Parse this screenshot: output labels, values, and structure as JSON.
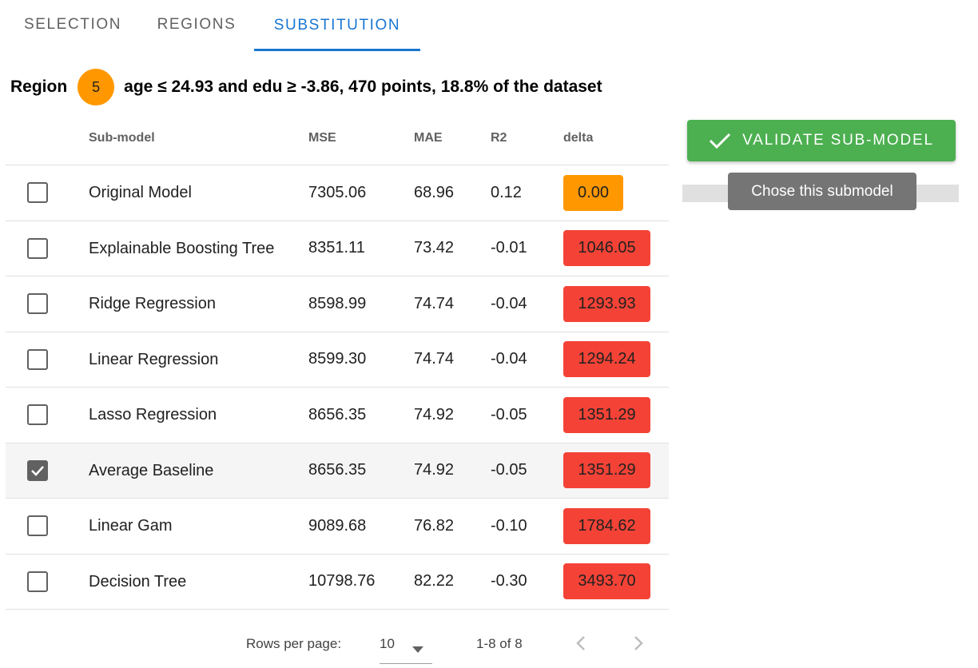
{
  "tabs": [
    {
      "label": "SELECTION",
      "active": false
    },
    {
      "label": "REGIONS",
      "active": false
    },
    {
      "label": "SUBSTITUTION",
      "active": true
    }
  ],
  "region": {
    "label": "Region",
    "number": "5",
    "description": "age ≤ 24.93 and edu ≥ -3.86, 470 points, 18.8% of the dataset",
    "badge_color": "#ff9800"
  },
  "table": {
    "headers": {
      "name": "Sub-model",
      "mse": "MSE",
      "mae": "MAE",
      "r2": "R2",
      "delta": "delta"
    },
    "rows": [
      {
        "name": "Original Model",
        "mse": "7305.06",
        "mae": "68.96",
        "r2": "0.12",
        "delta": "0.00",
        "delta_color": "orange",
        "checked": false
      },
      {
        "name": "Explainable Boosting Tree",
        "mse": "8351.11",
        "mae": "73.42",
        "r2": "-0.01",
        "delta": "1046.05",
        "delta_color": "red",
        "checked": false
      },
      {
        "name": "Ridge Regression",
        "mse": "8598.99",
        "mae": "74.74",
        "r2": "-0.04",
        "delta": "1293.93",
        "delta_color": "red",
        "checked": false
      },
      {
        "name": "Linear Regression",
        "mse": "8599.30",
        "mae": "74.74",
        "r2": "-0.04",
        "delta": "1294.24",
        "delta_color": "red",
        "checked": false
      },
      {
        "name": "Lasso Regression",
        "mse": "8656.35",
        "mae": "74.92",
        "r2": "-0.05",
        "delta": "1351.29",
        "delta_color": "red",
        "checked": false
      },
      {
        "name": "Average Baseline",
        "mse": "8656.35",
        "mae": "74.92",
        "r2": "-0.05",
        "delta": "1351.29",
        "delta_color": "red",
        "checked": true
      },
      {
        "name": "Linear Gam",
        "mse": "9089.68",
        "mae": "76.82",
        "r2": "-0.10",
        "delta": "1784.62",
        "delta_color": "red",
        "checked": false
      },
      {
        "name": "Decision Tree",
        "mse": "10798.76",
        "mae": "82.22",
        "r2": "-0.30",
        "delta": "3493.70",
        "delta_color": "red",
        "checked": false
      }
    ]
  },
  "pagination": {
    "rows_per_page_label": "Rows per page:",
    "rows_per_page_value": "10",
    "range_text": "1-8 of 8"
  },
  "actions": {
    "validate_label": "VALIDATE SUB-MODEL",
    "tooltip": "Chose this submodel"
  },
  "colors": {
    "accent": "#1976d2",
    "validate": "#4caf50",
    "delta_orange": "#ff9800",
    "delta_red": "#f44336"
  },
  "icons": {
    "validate": "check-icon",
    "checkbox_checked": "check-icon",
    "dropdown": "caret-down-icon",
    "prev": "chevron-left-icon",
    "next": "chevron-right-icon"
  }
}
